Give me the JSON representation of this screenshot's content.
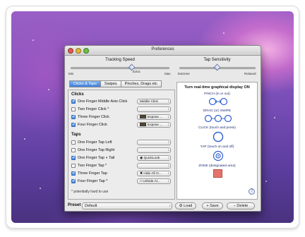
{
  "window": {
    "title": "Preferences"
  },
  "tracking": {
    "title": "Tracking Speed",
    "min": "Min",
    "extra": "Extra",
    "max": "Max",
    "level": 0.62
  },
  "tap": {
    "title": "Tap Sensitivity",
    "extreme": "Extreme",
    "relaxed": "Relaxed",
    "level": 0.5
  },
  "tabs": [
    "Clicks & Taps",
    "Swipes",
    "Pinches, Drags etc"
  ],
  "clicks": {
    "header": "Clicks",
    "rows": [
      {
        "label": "One Finger Middle Axis Click",
        "checked": true,
        "action": "Middle Click"
      },
      {
        "label": "Two Finger Click *",
        "checked": false,
        "action": ""
      },
      {
        "label": "Three Finger Click",
        "checked": true,
        "action": "Expose ..."
      },
      {
        "label": "Four Finger Click",
        "checked": true,
        "action": "Expose ..."
      }
    ]
  },
  "taps": {
    "header": "Taps",
    "rows": [
      {
        "label": "One Finger Tap Left",
        "checked": false,
        "action": ""
      },
      {
        "label": "One Finger Tap Right",
        "checked": false,
        "action": ""
      },
      {
        "label": "One Finger Tap ◖ Tail",
        "checked": true,
        "action": "QuickLook"
      },
      {
        "label": "Two Finger Tap *",
        "checked": false,
        "action": ""
      },
      {
        "label": "Three Finger Tap",
        "checked": true,
        "action": "Hide All O..."
      },
      {
        "label": "Four Finger Tap *",
        "checked": true,
        "action": "Unhide Al..."
      }
    ]
  },
  "footnote": "* potentially hard to use",
  "display": {
    "header": "Turn real-time graphical display ON",
    "captions": [
      "PINCH (in or out)",
      "DRAG (or) SWIPE",
      "CLICK (touch and press)",
      "TAP (touch on and off)",
      "ZONE (designated area)"
    ],
    "help": "?"
  },
  "preset": {
    "label": "Preset",
    "value": "Default"
  },
  "buttons": {
    "load": "Load",
    "save": "Save",
    "delete": "Delete"
  },
  "colors": {
    "accent": "#3d7ed9",
    "diagram": "#2f5fd0",
    "zone": "#e5736a"
  }
}
